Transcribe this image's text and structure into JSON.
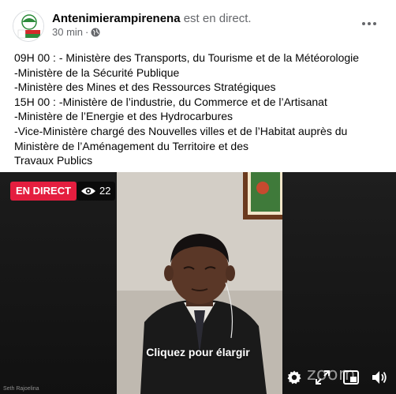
{
  "post": {
    "author": "Antenimierampirenena",
    "status_text": "est en direct.",
    "time": "30 min",
    "privacy_sep": "·",
    "text_lines": [
      "09H 00 : - Ministère des Transports, du Tourisme et de la Météorologie",
      "-Ministère de la Sécurité Publique",
      "-Ministère des Mines et des Ressources Stratégiques",
      "15H 00 : -Ministère de l’industrie, du Commerce et de l’Artisanat",
      "-Ministère de l’Energie et des Hydrocarbures",
      "-Vice-Ministère chargé des Nouvelles villes et de l’Habitat auprès du",
      "Ministère de l’Aménagement du Territoire et des",
      "Travaux Publics"
    ]
  },
  "video": {
    "live_badge": "EN DIRECT",
    "viewer_count": "22",
    "expand_hint": "Cliquez pour élargir",
    "watermark": "zoom",
    "participant_caption": "Seth Rajoelina",
    "badge_color": "#e41e3f"
  },
  "icons": {
    "privacy": "globe-icon",
    "viewers": "eye-icon",
    "settings": "gear-icon",
    "fullscreen": "expand-icon",
    "pip": "picture-in-picture-icon",
    "volume": "speaker-icon"
  }
}
